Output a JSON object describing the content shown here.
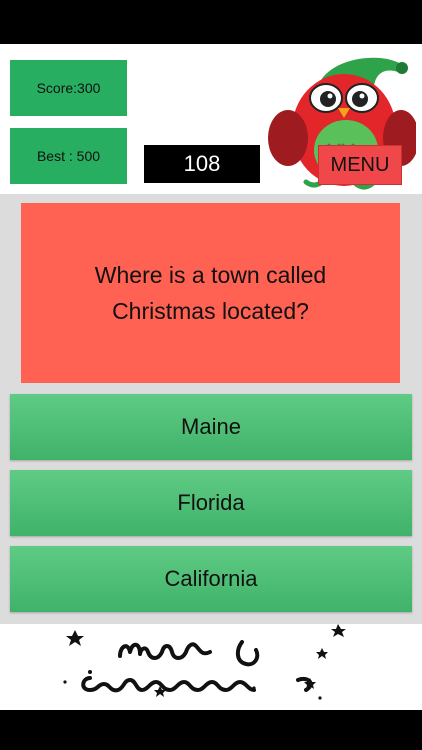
{
  "header": {
    "score_label": "Score:300",
    "best_label": "Best : 500",
    "timer_value": "108",
    "menu_label": "MENU"
  },
  "question": {
    "text": "Where is a town called Christmas located?"
  },
  "answers": [
    {
      "label": "Maine"
    },
    {
      "label": "Florida"
    },
    {
      "label": "California"
    }
  ],
  "footer": {
    "banner_text": "Merry Christmas"
  },
  "colors": {
    "score_box": "#27ae60",
    "question_bg": "#ff6152",
    "answer_bg": "#4fbf76",
    "menu_bg": "#f0484a"
  },
  "icons": {
    "mascot": "christmas-owl-icon",
    "banner": "merry-christmas-banner"
  }
}
